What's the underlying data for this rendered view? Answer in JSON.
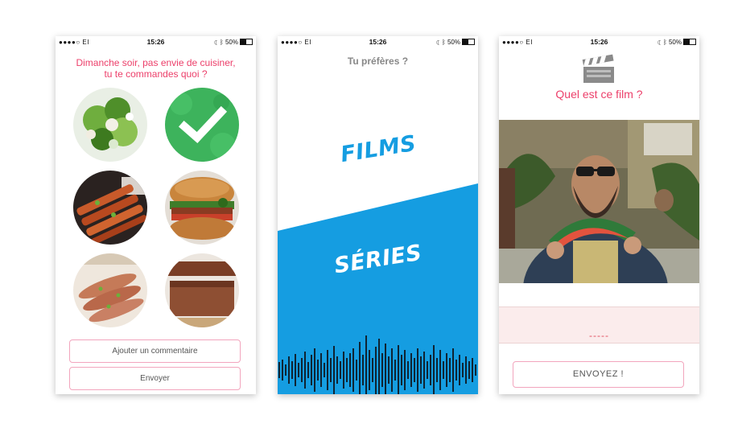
{
  "status_bar": {
    "signal": "●●●●○ EI",
    "time": "15:26",
    "battery": "50%"
  },
  "screen1": {
    "question_line1": "Dimanche soir, pas envie de cuisiner,",
    "question_line2": "tu te commandes quoi ?",
    "options": [
      {
        "name": "salad",
        "selected": false
      },
      {
        "name": "selected",
        "selected": true
      },
      {
        "name": "skewers",
        "selected": false
      },
      {
        "name": "burger",
        "selected": false
      },
      {
        "name": "duck",
        "selected": false
      },
      {
        "name": "cake",
        "selected": false
      }
    ],
    "comment_button": "Ajouter un commentaire",
    "send_button": "Envoyer"
  },
  "screen2": {
    "question": "Tu préfères ?",
    "option_top": "FILMS",
    "option_bottom": "SÉRIES",
    "colors": {
      "accent": "#159de1"
    }
  },
  "screen3": {
    "question": "Quel est ce film ?",
    "answer_placeholder": "-----",
    "send_button": "ENVOYEZ !"
  },
  "colors": {
    "pink": "#ec3f6a",
    "blue": "#159de1",
    "answer_bg": "#fbecec"
  }
}
